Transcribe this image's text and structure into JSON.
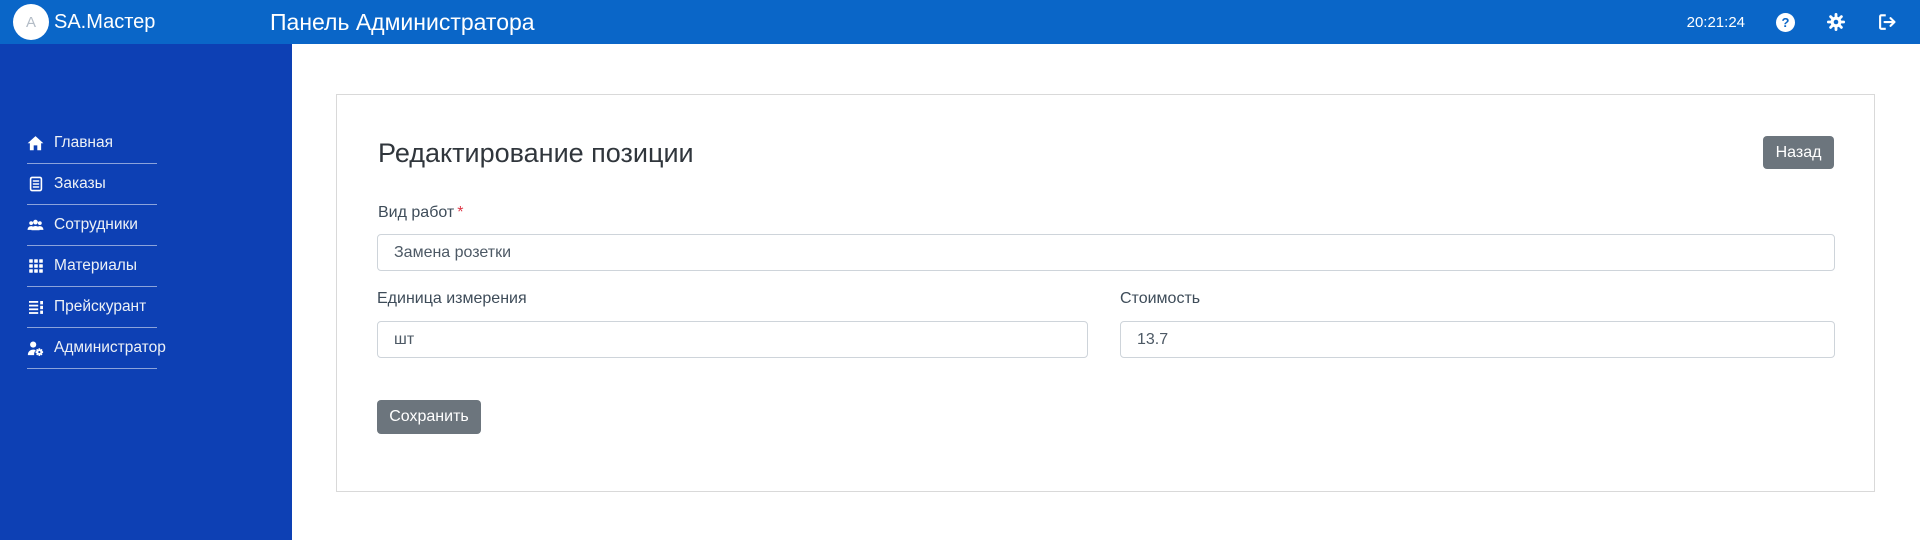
{
  "header": {
    "avatar_letter": "A",
    "logo_text": "SA.Мастер",
    "title": "Панель Администратора",
    "time": "20:21:24",
    "help_glyph": "?",
    "icons": [
      "help-icon",
      "settings-gear-icon",
      "logout-icon"
    ]
  },
  "sidebar": {
    "items": [
      {
        "label": "Главная",
        "icon": "home-icon"
      },
      {
        "label": "Заказы",
        "icon": "orders-document-icon"
      },
      {
        "label": "Сотрудники",
        "icon": "employees-users-icon"
      },
      {
        "label": "Материалы",
        "icon": "materials-grid-icon"
      },
      {
        "label": "Прейскурант",
        "icon": "pricelist-icon"
      },
      {
        "label": "Администратор",
        "icon": "admin-user-gear-icon"
      }
    ]
  },
  "main": {
    "heading": "Редактирование позиции",
    "back_button": "Назад",
    "save_button": "Сохранить",
    "fields": {
      "work_type": {
        "label": "Вид работ",
        "required_mark": "*",
        "value": "Замена розетки"
      },
      "unit": {
        "label": "Единица измерения",
        "value": "шт"
      },
      "cost": {
        "label": "Стоимость",
        "value": "13.7"
      }
    }
  },
  "colors": {
    "header_blue": "#0a66c8",
    "sidebar_blue": "#0d40b4",
    "button_gray": "#6c757d",
    "required_red": "#dc3545",
    "card_border": "#d9d9d9"
  }
}
